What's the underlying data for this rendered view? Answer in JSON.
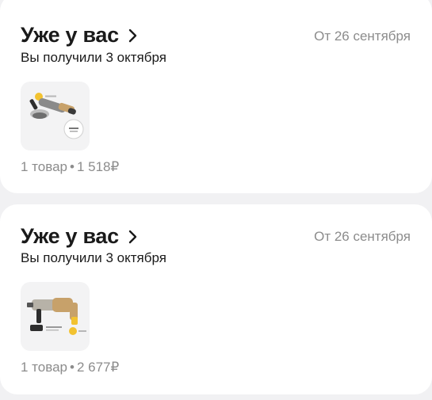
{
  "orders": [
    {
      "title": "Уже у вас",
      "date": "От 26 сентября",
      "status": "Вы получили 3 октября",
      "item_count": "1 товар",
      "separator": "•",
      "price": "1 518₽",
      "product_icon": "angle-grinder-image"
    },
    {
      "title": "Уже у вас",
      "date": "От 26 сентября",
      "status": "Вы получили 3 октября",
      "item_count": "1 товар",
      "separator": "•",
      "price": "2 677₽",
      "product_icon": "rotary-hammer-image"
    }
  ],
  "colors": {
    "background": "#f1f1f3",
    "card": "#ffffff",
    "muted_text": "#8c8c8c",
    "badge_yellow": "#f2c230"
  }
}
